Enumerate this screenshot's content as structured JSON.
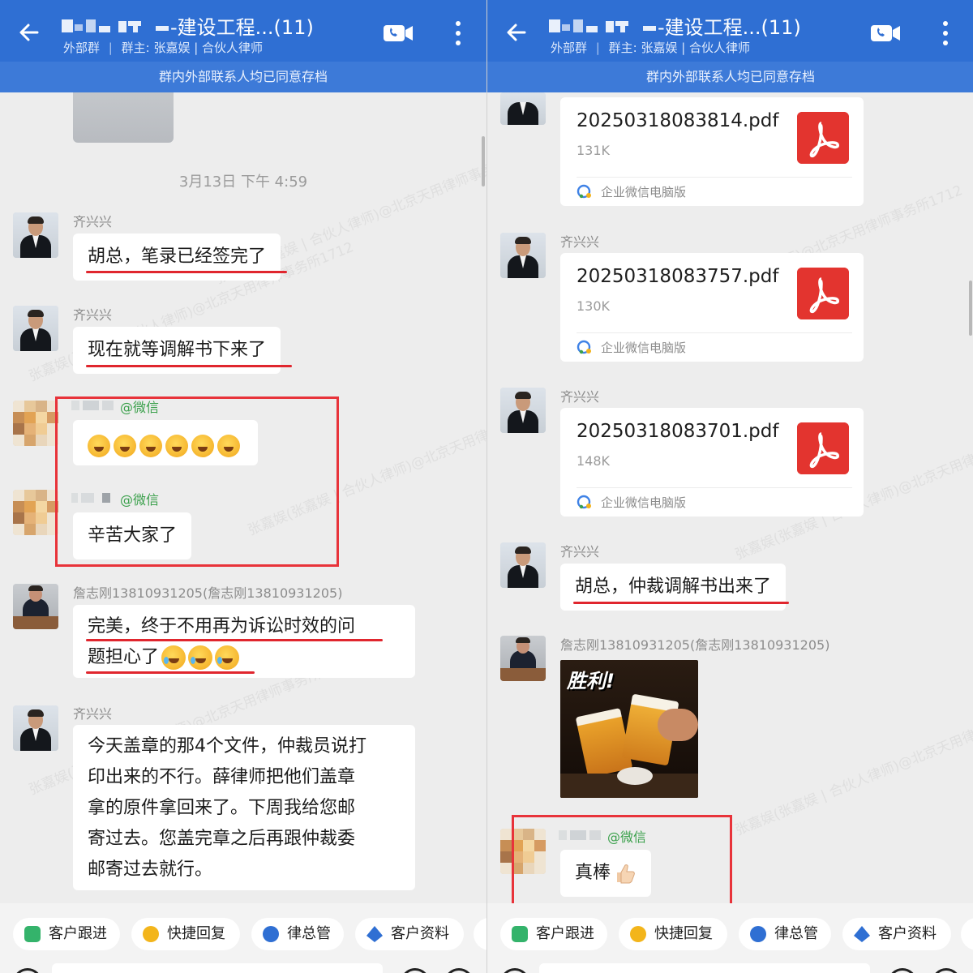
{
  "header": {
    "title_suffix": "-建设工程...(11)",
    "subtitle_group_type": "外部群",
    "subtitle_owner": "群主: 张嘉娱 | 合伙人律师"
  },
  "notice": "群内外部联系人均已同意存档",
  "left": {
    "timestamp": "3月13日 下午 4:59",
    "messages": [
      {
        "sender": "齐兴兴",
        "text": "胡总，笔录已经签完了"
      },
      {
        "sender": "齐兴兴",
        "text": "现在就等调解书下来了"
      },
      {
        "sender_tag": "@微信",
        "emoji_count": 6
      },
      {
        "sender_tag": "@微信",
        "text": "辛苦大家了"
      },
      {
        "sender": "詹志刚13810931205(詹志刚13810931205)",
        "text_line1": "完美，终于不用再为诉讼时效的问",
        "text_line2": "题担心了"
      },
      {
        "sender": "齐兴兴",
        "lines": [
          "今天盖章的那4个文件，仲裁员说打",
          "印出来的不行。薛律师把他们盖章",
          "拿的原件拿回来了。下周我给您邮",
          "寄过去。您盖完章之后再跟仲裁委",
          "邮寄过去就行。"
        ]
      }
    ]
  },
  "right": {
    "files": [
      {
        "name": "20250318083814.pdf",
        "size": "131K",
        "source": "企业微信电脑版"
      },
      {
        "sender": "齐兴兴",
        "name": "20250318083757.pdf",
        "size": "130K",
        "source": "企业微信电脑版"
      },
      {
        "sender": "齐兴兴",
        "name": "20250318083701.pdf",
        "size": "148K",
        "source": "企业微信电脑版"
      }
    ],
    "messages": [
      {
        "sender": "齐兴兴",
        "text": "胡总，仲裁调解书出来了"
      },
      {
        "sender": "詹志刚13810931205(詹志刚13810931205)",
        "image_caption": "胜利!"
      },
      {
        "sender_tag": "@微信",
        "text": "真棒"
      }
    ]
  },
  "quickbar": [
    "客户跟进",
    "快捷回复",
    "律总管",
    "客户资料"
  ],
  "watermark": "张嘉娱(张嘉娱 | 合伙人律师)@北京天用律师事务所1712",
  "colors": {
    "header": "#2f6fd3",
    "notice": "#3d7ad8",
    "underline": "#e0262e",
    "highlight": "#e8333a",
    "pdf": "#e3342f"
  }
}
